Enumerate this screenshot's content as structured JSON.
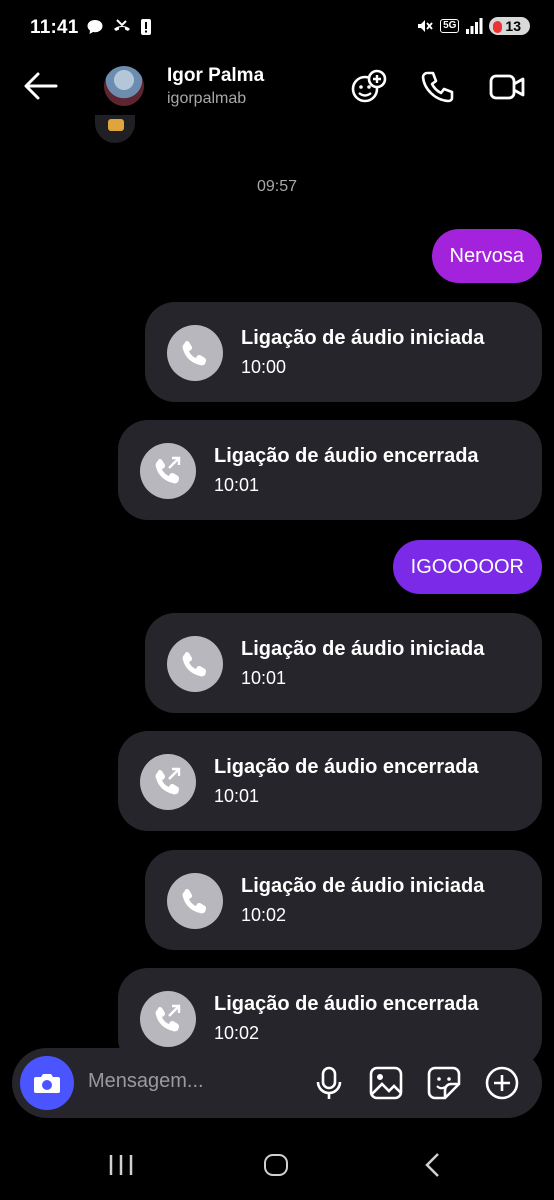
{
  "status_bar": {
    "time": "11:41",
    "network": "5G",
    "battery": "13"
  },
  "header": {
    "name": "Igor Palma",
    "username": "igorpalmab"
  },
  "conversation": {
    "timestamp": "09:57",
    "text_1": "Nervosa",
    "text_2": "IGOOOOOR",
    "calls": [
      {
        "title": "Ligação de áudio iniciada",
        "time": "10:00"
      },
      {
        "title": "Ligação de áudio encerrada",
        "time": "10:01"
      },
      {
        "title": "Ligação de áudio iniciada",
        "time": "10:01"
      },
      {
        "title": "Ligação de áudio encerrada",
        "time": "10:01"
      },
      {
        "title": "Ligação de áudio iniciada",
        "time": "10:02"
      },
      {
        "title": "Ligação de áudio encerrada",
        "time": "10:02"
      }
    ]
  },
  "composer": {
    "placeholder": "Mensagem..."
  },
  "colors": {
    "bubble_pink": "#a323dd",
    "bubble_violet": "#7b2be8",
    "card_bg": "#25252b",
    "camera_button": "#4a55ff"
  }
}
